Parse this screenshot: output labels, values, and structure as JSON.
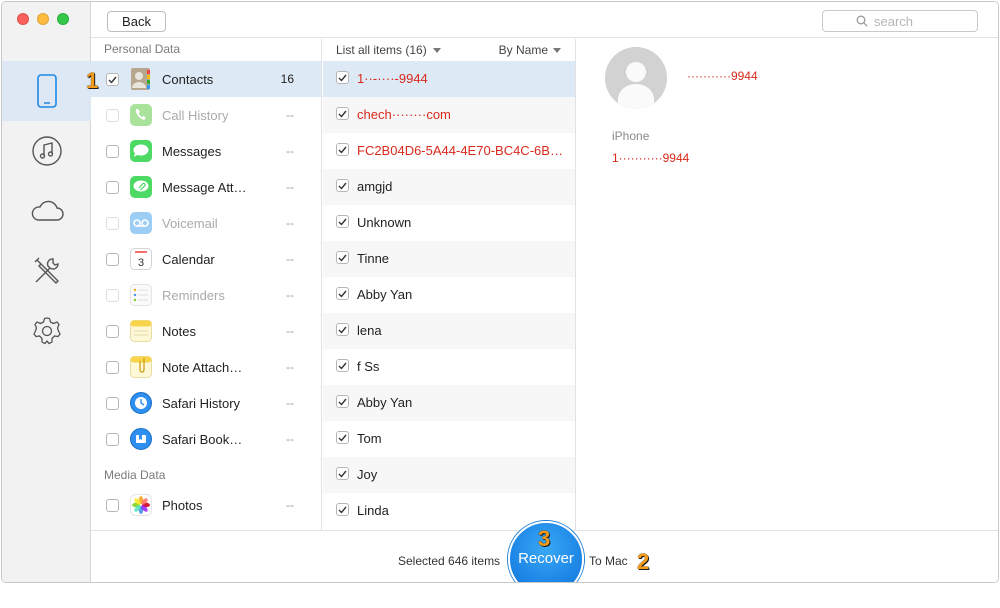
{
  "topbar": {
    "back_label": "Back",
    "search_placeholder": "search"
  },
  "rail": {
    "items": [
      {
        "icon": "iphone-icon",
        "active": true
      },
      {
        "icon": "music-icon",
        "active": false
      },
      {
        "icon": "cloud-icon",
        "active": false
      },
      {
        "icon": "tools-icon",
        "active": false
      },
      {
        "icon": "gear-icon",
        "active": false
      }
    ]
  },
  "categories": {
    "personal_title": "Personal Data",
    "media_title": "Media Data",
    "items": [
      {
        "label": "Contacts",
        "count": "16",
        "checked": true,
        "disabled": false,
        "selected": true,
        "icon": "contacts-icon"
      },
      {
        "label": "Call History",
        "count": "--",
        "checked": false,
        "disabled": true,
        "selected": false,
        "icon": "phone-icon"
      },
      {
        "label": "Messages",
        "count": "--",
        "checked": false,
        "disabled": false,
        "selected": false,
        "icon": "messages-icon"
      },
      {
        "label": "Message Att…",
        "count": "--",
        "checked": false,
        "disabled": false,
        "selected": false,
        "icon": "message-attachment-icon"
      },
      {
        "label": "Voicemail",
        "count": "--",
        "checked": false,
        "disabled": true,
        "selected": false,
        "icon": "voicemail-icon"
      },
      {
        "label": "Calendar",
        "count": "--",
        "checked": false,
        "disabled": false,
        "selected": false,
        "icon": "calendar-icon",
        "icon_text": "3"
      },
      {
        "label": "Reminders",
        "count": "--",
        "checked": false,
        "disabled": true,
        "selected": false,
        "icon": "reminders-icon"
      },
      {
        "label": "Notes",
        "count": "--",
        "checked": false,
        "disabled": false,
        "selected": false,
        "icon": "notes-icon"
      },
      {
        "label": "Note Attach…",
        "count": "--",
        "checked": false,
        "disabled": false,
        "selected": false,
        "icon": "note-attachment-icon"
      },
      {
        "label": "Safari History",
        "count": "--",
        "checked": false,
        "disabled": false,
        "selected": false,
        "icon": "safari-history-icon"
      },
      {
        "label": "Safari Book…",
        "count": "--",
        "checked": false,
        "disabled": false,
        "selected": false,
        "icon": "safari-bookmark-icon"
      }
    ],
    "media_items": [
      {
        "label": "Photos",
        "count": "--",
        "checked": false,
        "disabled": false,
        "selected": false,
        "icon": "photos-icon"
      }
    ]
  },
  "items_list": {
    "header_label": "List all items (16)",
    "sort_label": "By Name",
    "rows": [
      {
        "text": "1··-····-9944",
        "red": true,
        "selected": true
      },
      {
        "text": "chech········com",
        "red": true,
        "selected": false
      },
      {
        "text": "FC2B04D6-5A44-4E70-BC4C-6B100…",
        "red": true,
        "selected": false
      },
      {
        "text": "amgjd",
        "red": false,
        "selected": false
      },
      {
        "text": "Unknown",
        "red": false,
        "selected": false
      },
      {
        "text": "Tinne",
        "red": false,
        "selected": false
      },
      {
        "text": "Abby Yan",
        "red": false,
        "selected": false
      },
      {
        "text": "lena",
        "red": false,
        "selected": false
      },
      {
        "text": "f Ss",
        "red": false,
        "selected": false
      },
      {
        "text": "Abby Yan",
        "red": false,
        "selected": false
      },
      {
        "text": "Tom",
        "red": false,
        "selected": false
      },
      {
        "text": "Joy",
        "red": false,
        "selected": false
      },
      {
        "text": "Linda",
        "red": false,
        "selected": false
      }
    ]
  },
  "detail": {
    "name": "···········9944",
    "field_label": "iPhone",
    "field_value": "1···········9944"
  },
  "bottom": {
    "selected_text": "Selected 646 items",
    "recover_label": "Recover",
    "to_mac_label": "To Mac"
  },
  "badges": {
    "one": "1",
    "two": "2",
    "three": "3"
  },
  "colors": {
    "accent": "#1d86e6",
    "highlight_red": "#d9291b",
    "selection": "#dde9f5",
    "badge": "#f39a1a"
  }
}
